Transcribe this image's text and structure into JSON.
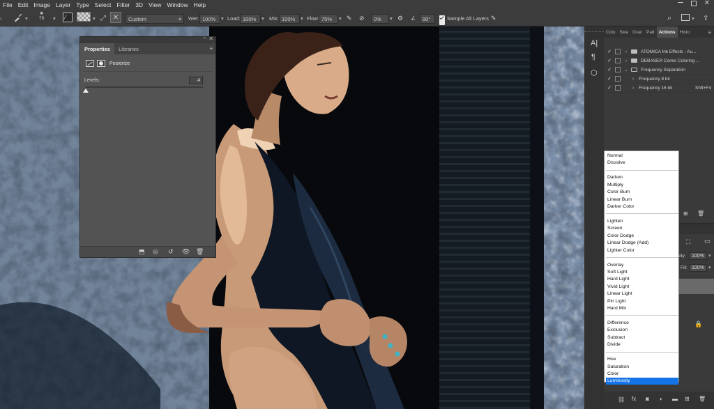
{
  "menu": [
    "File",
    "Edit",
    "Image",
    "Layer",
    "Type",
    "Select",
    "Filter",
    "3D",
    "View",
    "Window",
    "Help"
  ],
  "options": {
    "brush_size": "79",
    "preset": "Custom",
    "wet_label": "Wet:",
    "wet": "100%",
    "load_label": "Load:",
    "load": "100%",
    "mix_label": "Mix:",
    "mix": "100%",
    "flow_label": "Flow:",
    "flow": "75%",
    "smoothing": "0%",
    "angle": "90°",
    "sample_all_layers": "Sample All Layers"
  },
  "properties": {
    "tabs": [
      "Properties",
      "Libraries"
    ],
    "adjustment": "Posterize",
    "levels_label": "Levels:",
    "levels_value": "4",
    "levels_fraction": 0.0
  },
  "dock": {
    "tabs": [
      "Colo",
      "Swa",
      "Grac",
      "Patt",
      "Actions",
      "Histo"
    ],
    "actions": [
      {
        "name": "ATOMICA Ink Effects - Au...",
        "type": "set",
        "shortcut": ""
      },
      {
        "name": "DEBASER Comic Coloring ...",
        "type": "set",
        "shortcut": ""
      },
      {
        "name": "Frequency Separation",
        "type": "set-open",
        "shortcut": ""
      },
      {
        "name": "Frequency 8 bit",
        "type": "action",
        "shortcut": ""
      },
      {
        "name": "Frequency 16 bit",
        "type": "action",
        "shortcut": "Shft+F4"
      }
    ],
    "opacity_label": "city:",
    "opacity": "100%",
    "fill_label": "Fill:",
    "fill": "100%"
  },
  "blend_modes": [
    [
      "Normal",
      "Dissolve"
    ],
    [
      "Darken",
      "Multiply",
      "Color Burn",
      "Linear Burn",
      "Darker Color"
    ],
    [
      "Lighten",
      "Screen",
      "Color Dodge",
      "Linear Dodge (Add)",
      "Lighter Color"
    ],
    [
      "Overlay",
      "Soft Light",
      "Hard Light",
      "Vivid Light",
      "Linear Light",
      "Pin Light",
      "Hard Mix"
    ],
    [
      "Difference",
      "Exclusion",
      "Subtract",
      "Divide"
    ],
    [
      "Hue",
      "Saturation",
      "Color",
      "Luminosity"
    ]
  ],
  "blend_selected": "Luminosity",
  "colors": {
    "accent": "#1473e6",
    "panel": "#535353",
    "chrome": "#3c3c3c"
  }
}
